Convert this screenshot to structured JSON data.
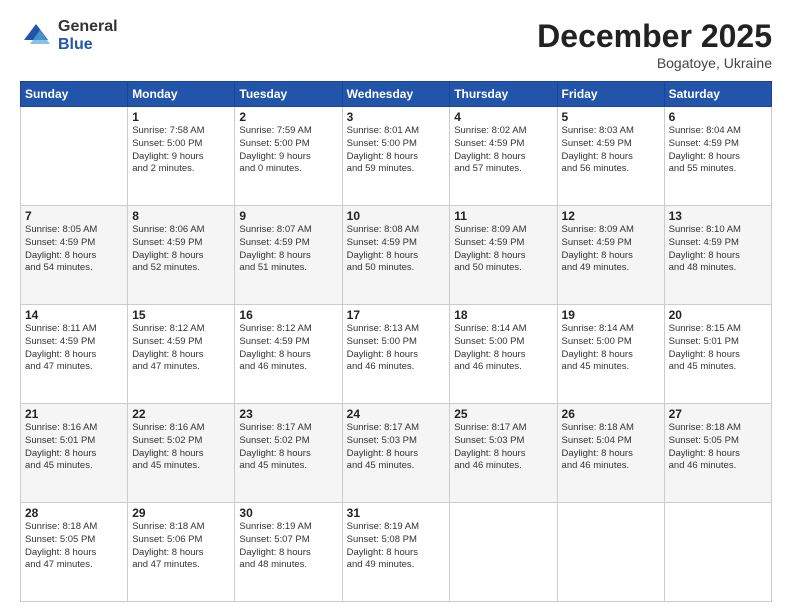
{
  "header": {
    "logo_general": "General",
    "logo_blue": "Blue",
    "month_title": "December 2025",
    "location": "Bogatoye, Ukraine"
  },
  "weekdays": [
    "Sunday",
    "Monday",
    "Tuesday",
    "Wednesday",
    "Thursday",
    "Friday",
    "Saturday"
  ],
  "weeks": [
    [
      {
        "day": "",
        "info": ""
      },
      {
        "day": "1",
        "info": "Sunrise: 7:58 AM\nSunset: 5:00 PM\nDaylight: 9 hours\nand 2 minutes."
      },
      {
        "day": "2",
        "info": "Sunrise: 7:59 AM\nSunset: 5:00 PM\nDaylight: 9 hours\nand 0 minutes."
      },
      {
        "day": "3",
        "info": "Sunrise: 8:01 AM\nSunset: 5:00 PM\nDaylight: 8 hours\nand 59 minutes."
      },
      {
        "day": "4",
        "info": "Sunrise: 8:02 AM\nSunset: 4:59 PM\nDaylight: 8 hours\nand 57 minutes."
      },
      {
        "day": "5",
        "info": "Sunrise: 8:03 AM\nSunset: 4:59 PM\nDaylight: 8 hours\nand 56 minutes."
      },
      {
        "day": "6",
        "info": "Sunrise: 8:04 AM\nSunset: 4:59 PM\nDaylight: 8 hours\nand 55 minutes."
      }
    ],
    [
      {
        "day": "7",
        "info": "Sunrise: 8:05 AM\nSunset: 4:59 PM\nDaylight: 8 hours\nand 54 minutes."
      },
      {
        "day": "8",
        "info": "Sunrise: 8:06 AM\nSunset: 4:59 PM\nDaylight: 8 hours\nand 52 minutes."
      },
      {
        "day": "9",
        "info": "Sunrise: 8:07 AM\nSunset: 4:59 PM\nDaylight: 8 hours\nand 51 minutes."
      },
      {
        "day": "10",
        "info": "Sunrise: 8:08 AM\nSunset: 4:59 PM\nDaylight: 8 hours\nand 50 minutes."
      },
      {
        "day": "11",
        "info": "Sunrise: 8:09 AM\nSunset: 4:59 PM\nDaylight: 8 hours\nand 50 minutes."
      },
      {
        "day": "12",
        "info": "Sunrise: 8:09 AM\nSunset: 4:59 PM\nDaylight: 8 hours\nand 49 minutes."
      },
      {
        "day": "13",
        "info": "Sunrise: 8:10 AM\nSunset: 4:59 PM\nDaylight: 8 hours\nand 48 minutes."
      }
    ],
    [
      {
        "day": "14",
        "info": "Sunrise: 8:11 AM\nSunset: 4:59 PM\nDaylight: 8 hours\nand 47 minutes."
      },
      {
        "day": "15",
        "info": "Sunrise: 8:12 AM\nSunset: 4:59 PM\nDaylight: 8 hours\nand 47 minutes."
      },
      {
        "day": "16",
        "info": "Sunrise: 8:12 AM\nSunset: 4:59 PM\nDaylight: 8 hours\nand 46 minutes."
      },
      {
        "day": "17",
        "info": "Sunrise: 8:13 AM\nSunset: 5:00 PM\nDaylight: 8 hours\nand 46 minutes."
      },
      {
        "day": "18",
        "info": "Sunrise: 8:14 AM\nSunset: 5:00 PM\nDaylight: 8 hours\nand 46 minutes."
      },
      {
        "day": "19",
        "info": "Sunrise: 8:14 AM\nSunset: 5:00 PM\nDaylight: 8 hours\nand 45 minutes."
      },
      {
        "day": "20",
        "info": "Sunrise: 8:15 AM\nSunset: 5:01 PM\nDaylight: 8 hours\nand 45 minutes."
      }
    ],
    [
      {
        "day": "21",
        "info": "Sunrise: 8:16 AM\nSunset: 5:01 PM\nDaylight: 8 hours\nand 45 minutes."
      },
      {
        "day": "22",
        "info": "Sunrise: 8:16 AM\nSunset: 5:02 PM\nDaylight: 8 hours\nand 45 minutes."
      },
      {
        "day": "23",
        "info": "Sunrise: 8:17 AM\nSunset: 5:02 PM\nDaylight: 8 hours\nand 45 minutes."
      },
      {
        "day": "24",
        "info": "Sunrise: 8:17 AM\nSunset: 5:03 PM\nDaylight: 8 hours\nand 45 minutes."
      },
      {
        "day": "25",
        "info": "Sunrise: 8:17 AM\nSunset: 5:03 PM\nDaylight: 8 hours\nand 46 minutes."
      },
      {
        "day": "26",
        "info": "Sunrise: 8:18 AM\nSunset: 5:04 PM\nDaylight: 8 hours\nand 46 minutes."
      },
      {
        "day": "27",
        "info": "Sunrise: 8:18 AM\nSunset: 5:05 PM\nDaylight: 8 hours\nand 46 minutes."
      }
    ],
    [
      {
        "day": "28",
        "info": "Sunrise: 8:18 AM\nSunset: 5:05 PM\nDaylight: 8 hours\nand 47 minutes."
      },
      {
        "day": "29",
        "info": "Sunrise: 8:18 AM\nSunset: 5:06 PM\nDaylight: 8 hours\nand 47 minutes."
      },
      {
        "day": "30",
        "info": "Sunrise: 8:19 AM\nSunset: 5:07 PM\nDaylight: 8 hours\nand 48 minutes."
      },
      {
        "day": "31",
        "info": "Sunrise: 8:19 AM\nSunset: 5:08 PM\nDaylight: 8 hours\nand 49 minutes."
      },
      {
        "day": "",
        "info": ""
      },
      {
        "day": "",
        "info": ""
      },
      {
        "day": "",
        "info": ""
      }
    ]
  ]
}
